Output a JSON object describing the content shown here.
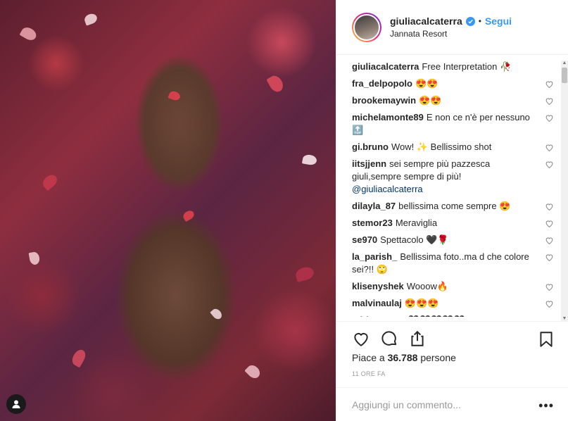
{
  "post": {
    "image_alt_icon": "user-tag-icon"
  },
  "header": {
    "username": "giuliacalcaterra",
    "separator": "•",
    "follow_label": "Segui",
    "location": "Jannata Resort"
  },
  "comments": [
    {
      "user": "giuliacalcaterra",
      "text": "Free Interpretation 🥀",
      "heart": false
    },
    {
      "user": "fra_delpopolo",
      "text": "😍😍",
      "heart": true
    },
    {
      "user": "brookemaywin",
      "text": "😍😍",
      "heart": true
    },
    {
      "user": "michelamonte89",
      "text": "E non ce n'è per nessuno 🔝",
      "heart": true
    },
    {
      "user": "gi.bruno",
      "text": "Wow! ✨ Bellissimo shot",
      "heart": true
    },
    {
      "user": "iitsjjenn",
      "text": "sei sempre più pazzesca giuli,sempre sempre di più!",
      "mention": "@giuliacalcaterra",
      "heart": true
    },
    {
      "user": "dilayla_87",
      "text": "bellissima come sempre 😍",
      "heart": true
    },
    {
      "user": "stemor23",
      "text": "Meraviglia",
      "heart": true
    },
    {
      "user": "se970",
      "text": "Spettacolo 🖤🌹",
      "heart": true
    },
    {
      "user": "la_parish_",
      "text": "Bellissima foto..ma d che colore sei?!! 🙄",
      "heart": true
    },
    {
      "user": "klisenyshek",
      "text": "Wooow🔥",
      "heart": true
    },
    {
      "user": "malvinaulaj",
      "text": "😍😍😍",
      "heart": true
    },
    {
      "user": "adrianaanaa",
      "text": "🖤🖤🖤🖤🖤",
      "heart": true
    }
  ],
  "actions": {
    "like_icon": "heart-icon",
    "comment_icon": "comment-icon",
    "share_icon": "share-icon",
    "save_icon": "bookmark-icon"
  },
  "likes": {
    "prefix": "Piace a",
    "count": "36.788",
    "suffix": "persone"
  },
  "timestamp": "11 ORE FA",
  "add_comment": {
    "placeholder": "Aggiungi un commento...",
    "more": "•••"
  },
  "colors": {
    "accent": "#3897f0",
    "mention": "#003569",
    "muted": "#999999"
  }
}
